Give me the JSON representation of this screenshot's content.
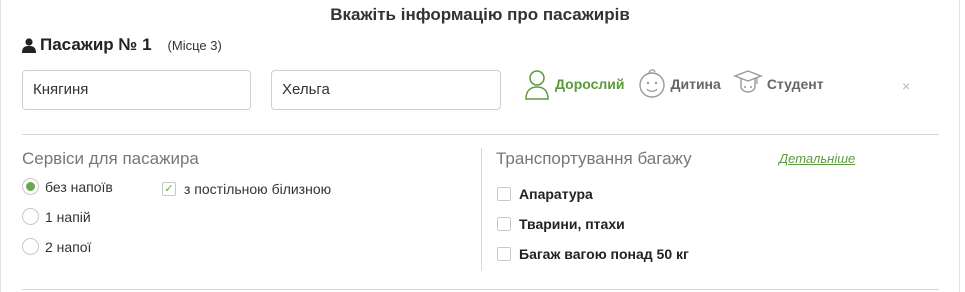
{
  "heading": "Вкажіть інформацію про пасажирів",
  "passenger": {
    "title": "Пасажир № 1",
    "seat": "(Місце 3)",
    "last_name": "Княгиня",
    "first_name": "Хельга"
  },
  "types": {
    "adult": "Дорослий",
    "child": "Дитина",
    "student": "Студент",
    "selected": "adult"
  },
  "close_label": "×",
  "services": {
    "title": "Сервіси для пасажира",
    "drinks": [
      "без напоїв",
      "1 напій",
      "2 напої"
    ],
    "selected_drink": "без напоїв",
    "bedding_label": "з постільною білизною",
    "bedding_checked": true
  },
  "baggage": {
    "title": "Транспортування багажу",
    "details_link": "Детальніше",
    "options": [
      "Апаратура",
      "Тварини, птахи",
      "Багаж вагою понад 50 кг"
    ]
  },
  "colors": {
    "accent": "#5a9a3c",
    "muted_text": "#777777",
    "border": "#cfcfcf"
  }
}
